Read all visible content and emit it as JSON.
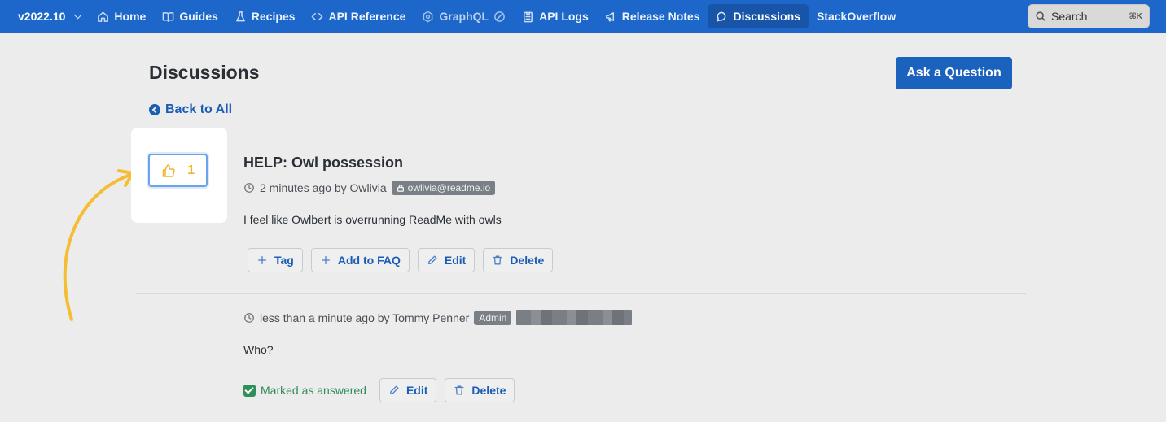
{
  "nav": {
    "version": "v2022.10",
    "items": [
      {
        "label": "Home",
        "icon": "home-icon"
      },
      {
        "label": "Guides",
        "icon": "book-icon"
      },
      {
        "label": "Recipes",
        "icon": "flask-icon"
      },
      {
        "label": "API Reference",
        "icon": "code-icon"
      },
      {
        "label": "GraphQL",
        "icon": "graphql-icon"
      },
      {
        "label": "API Logs",
        "icon": "clipboard-icon"
      },
      {
        "label": "Release Notes",
        "icon": "megaphone-icon"
      },
      {
        "label": "Discussions",
        "icon": "chat-icon"
      },
      {
        "label": "StackOverflow",
        "icon": ""
      }
    ],
    "search_label": "Search",
    "search_shortcut": "⌘K"
  },
  "page": {
    "title": "Discussions",
    "ask_button": "Ask a Question",
    "back_link": "Back to All"
  },
  "question": {
    "vote_count": "1",
    "title": "HELP: Owl possession",
    "time": "2 minutes ago by Owlivia",
    "email_badge": "owlivia@readme.io",
    "body": "I feel like Owlbert is overrunning ReadMe with owls",
    "actions": [
      "Tag",
      "Add to FAQ",
      "Edit",
      "Delete"
    ]
  },
  "answer": {
    "time": "less than a minute ago by Tommy Penner",
    "role_badge": "Admin",
    "body": "Who?",
    "answered_label": "Marked as answered",
    "actions": [
      "Edit",
      "Delete"
    ]
  },
  "colors": {
    "nav_bg": "#1c67c9",
    "accent": "#1b62bf",
    "vote": "#f0b429",
    "answered": "#2e8b57"
  }
}
